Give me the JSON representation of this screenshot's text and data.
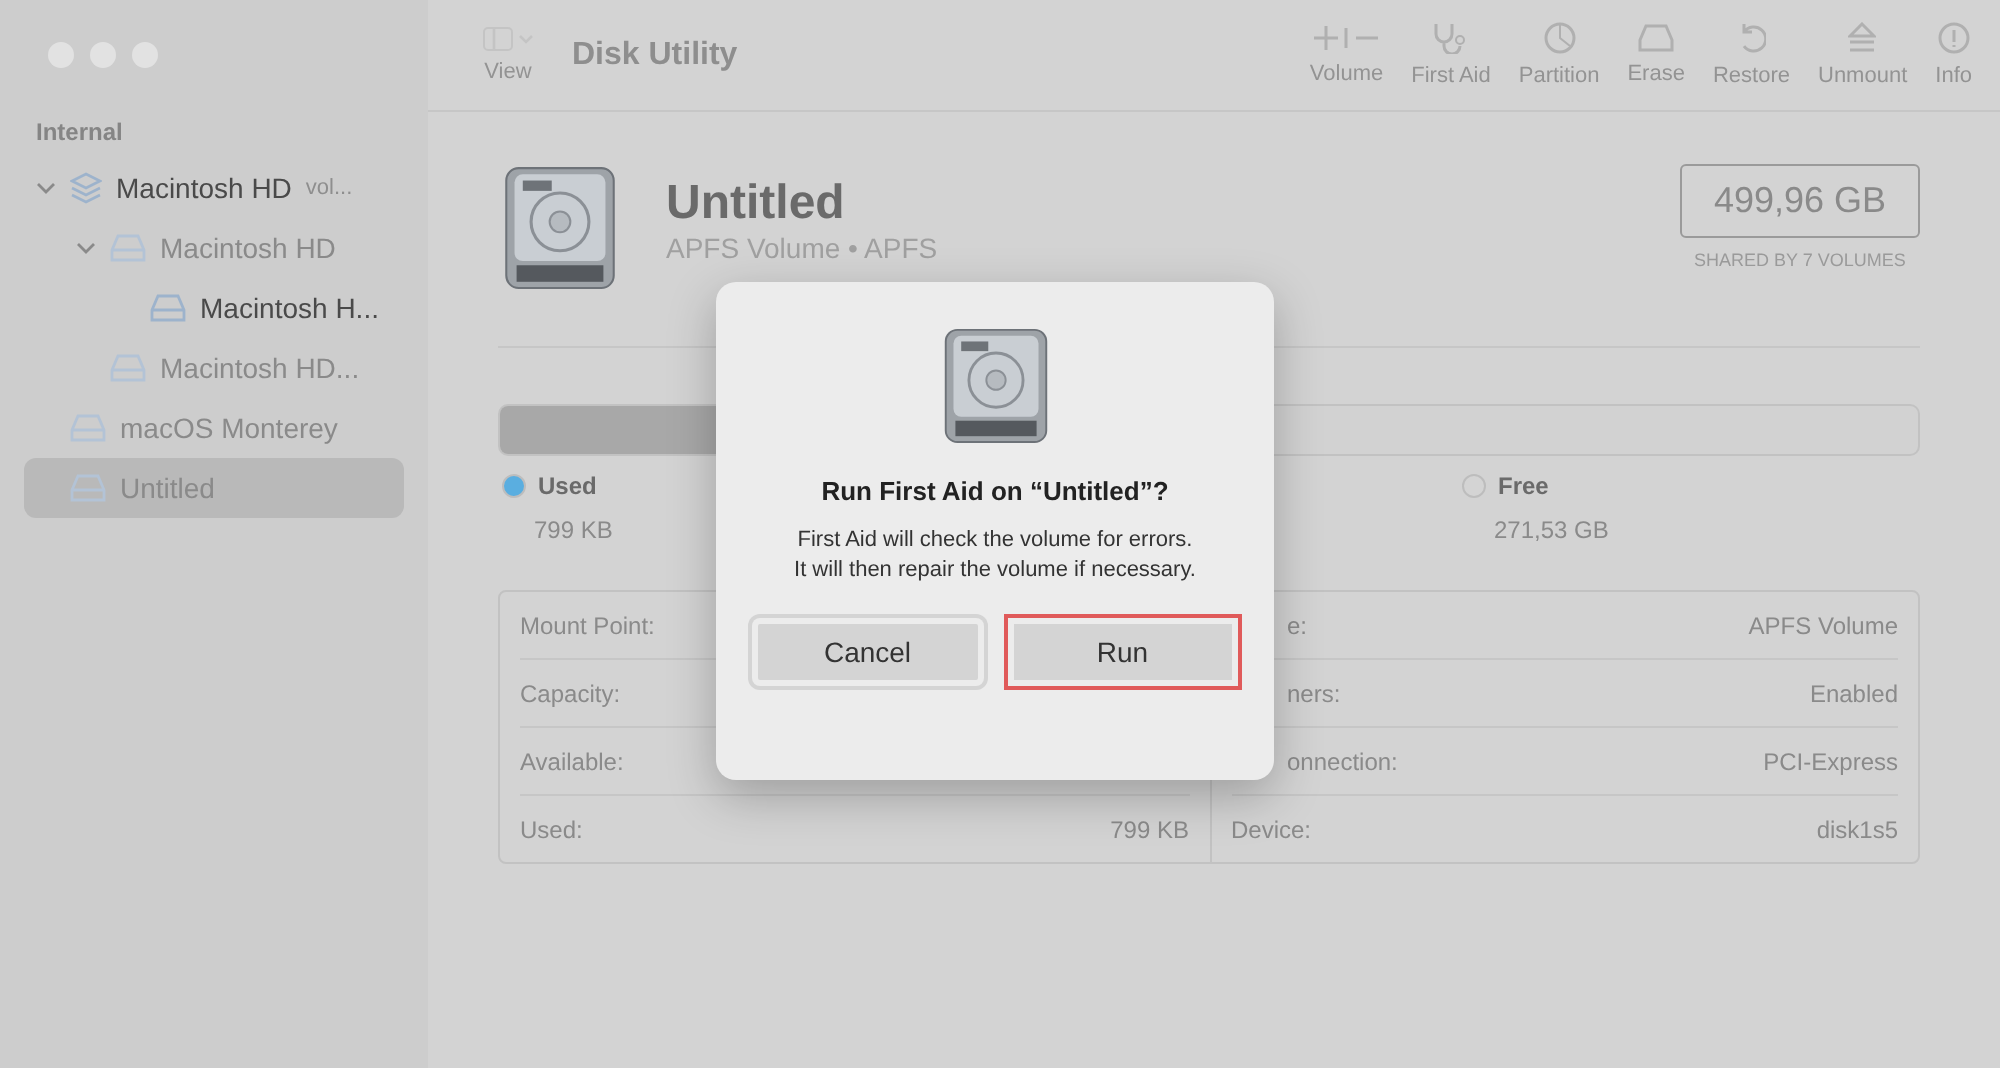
{
  "window": {
    "title": "Disk Utility",
    "view_label": "View"
  },
  "toolbar": [
    {
      "label": "Volume",
      "disabled": true
    },
    {
      "label": "First Aid",
      "disabled": true
    },
    {
      "label": "Partition",
      "disabled": true
    },
    {
      "label": "Erase",
      "disabled": true
    },
    {
      "label": "Restore",
      "disabled": true
    },
    {
      "label": "Unmount",
      "disabled": true
    },
    {
      "label": "Info",
      "disabled": true
    }
  ],
  "sidebar": {
    "section": "Internal",
    "items": [
      {
        "kind": "container",
        "label": "Macintosh HD",
        "suffix": "vol...",
        "dimmed": false,
        "expanded": true,
        "selected": false,
        "children": [
          {
            "kind": "volume",
            "label": "Macintosh HD",
            "dimmed": true,
            "expanded": true,
            "selected": false,
            "children": [
              {
                "kind": "volume",
                "label": "Macintosh H...",
                "dimmed": false,
                "selected": false
              }
            ]
          },
          {
            "kind": "volume",
            "label": "Macintosh HD...",
            "dimmed": true,
            "selected": false
          }
        ]
      },
      {
        "kind": "volume",
        "label": "macOS Monterey",
        "dimmed": true,
        "selected": false
      },
      {
        "kind": "volume",
        "label": "Untitled",
        "dimmed": true,
        "selected": true
      }
    ]
  },
  "volume": {
    "name": "Untitled",
    "subtitle": "APFS Volume • APFS",
    "size": "499,96 GB",
    "shared": "SHARED BY 7 VOLUMES"
  },
  "usage": {
    "level": 0.45,
    "legend": [
      {
        "label": "Used",
        "value": "799 KB",
        "color": "#5aaee0"
      },
      {
        "label": "Free",
        "value": "271,53 GB",
        "color": "#d4d4d4"
      }
    ]
  },
  "info_left": [
    {
      "label": "Mount Point:"
    },
    {
      "label": "Capacity:"
    },
    {
      "label": "Available:"
    },
    {
      "label": "Used:",
      "value": "799 KB"
    }
  ],
  "info_right": [
    {
      "label": "e:",
      "value": "APFS Volume"
    },
    {
      "label": "ners:",
      "value": "Enabled"
    },
    {
      "label": "onnection:",
      "value": "PCI-Express"
    },
    {
      "label": "Device:",
      "value": "disk1s5"
    }
  ],
  "dialog": {
    "title": "Run First Aid on “Untitled”?",
    "message": "First Aid will check the volume for errors. It will then repair the volume if necessary.",
    "buttons": [
      {
        "label": "Cancel",
        "highlighted": false
      },
      {
        "label": "Run",
        "highlighted": true
      }
    ]
  }
}
